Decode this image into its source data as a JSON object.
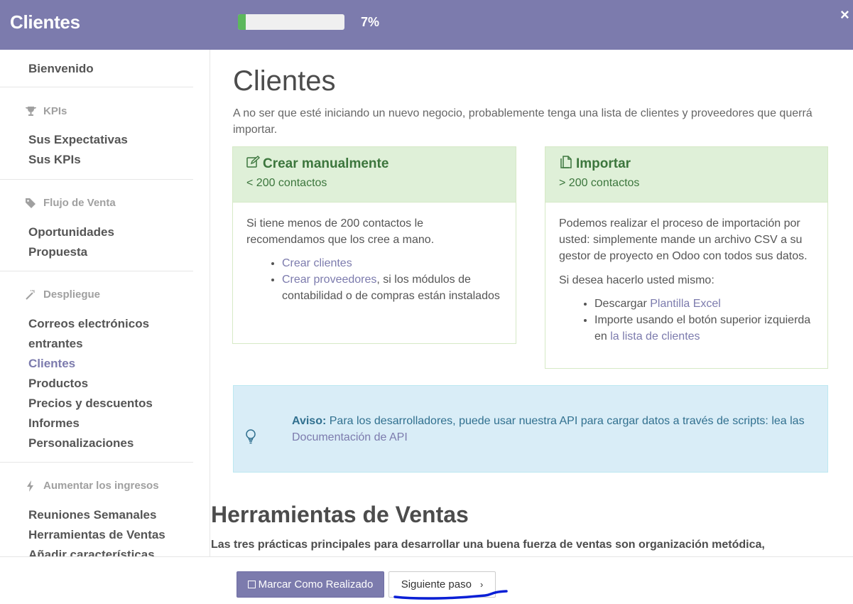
{
  "header": {
    "title": "Clientes",
    "progress_label": "7%",
    "progress_value": 0.07,
    "close_symbol": "×"
  },
  "sidebar": {
    "welcome": "Bienvenido",
    "sections": [
      {
        "icon": "trophy-icon",
        "title": "KPIs",
        "items": [
          "Sus Expectativas",
          "Sus KPIs"
        ]
      },
      {
        "icon": "tag-icon",
        "title": "Flujo de Venta",
        "items": [
          "Oportunidades",
          "Propuesta"
        ]
      },
      {
        "icon": "magic-wand-icon",
        "title": "Despliegue",
        "items": [
          "Correos electrónicos",
          "entrantes",
          "Clientes",
          "Productos",
          "Precios y descuentos",
          "Informes",
          "Personalizaciones"
        ]
      },
      {
        "icon": "bolt-icon",
        "title": "Aumentar los ingresos",
        "items": [
          "Reuniones Semanales",
          "Herramientas de Ventas",
          "Añadir características"
        ]
      }
    ],
    "active_item": "Clientes"
  },
  "main": {
    "title": "Clientes",
    "intro": "A no ser que esté iniciando un nuevo negocio, probablemente tenga una lista de clientes y proveedores que querrá importar.",
    "manual_card": {
      "title": "Crear manualmente",
      "subtitle": "< 200 contactos",
      "text": "Si tiene menos de 200 contactos le recomendamos que los cree a mano.",
      "link1": "Crear clientes",
      "link2": "Crear proveedores",
      "link2_suffix": ", si los módulos de contabilidad o de compras están instalados"
    },
    "import_card": {
      "title": "Importar",
      "subtitle": "> 200 contactos",
      "text": "Podemos realizar el proceso de importación por usted: simplemente mande un archivo CSV a su gestor de proyecto en Odoo con todos sus datos.",
      "text2": "Si desea hacerlo usted mismo:",
      "item1_prefix": "Descargar ",
      "item1_link": "Plantilla Excel",
      "item2_prefix": "Importe usando el botón superior izquierda en ",
      "item2_link": "la lista de clientes"
    },
    "hint": {
      "label": "Aviso:",
      "text": " Para los desarrolladores, puede usar nuestra API para cargar datos a través de scripts: lea las ",
      "link": "Documentación de API"
    },
    "section_title": "Herramientas de Ventas",
    "section_text": "Las tres prácticas principales para desarrollar una buena fuerza de ventas son organización metódica,"
  },
  "footer": {
    "done_label": "Marcar Como Realizado",
    "next_label": "Siguiente paso",
    "next_chevron": "›"
  },
  "colors": {
    "brand": "#7c7bad",
    "success_bg": "#dff0d8",
    "success_text": "#3c763d",
    "info_bg": "#d9edf7",
    "info_text": "#31708f",
    "progress": "#5cb85c",
    "annotation": "#0a1fd6"
  }
}
